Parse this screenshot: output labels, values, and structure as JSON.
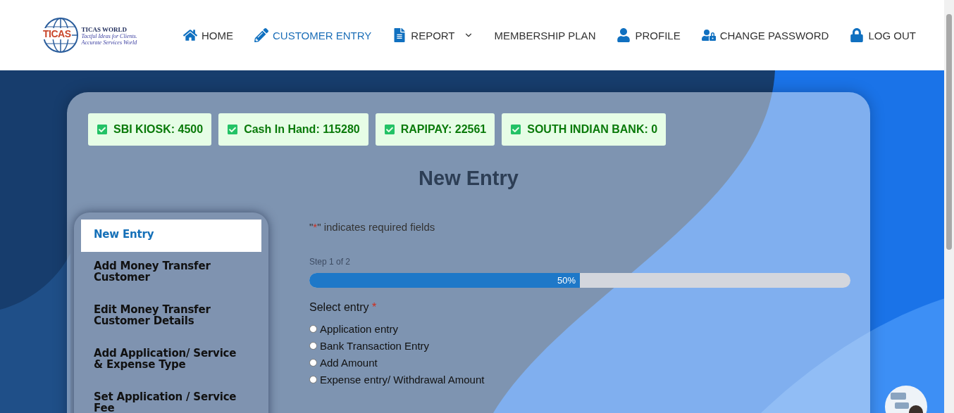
{
  "logo": {
    "mark": "TICAS",
    "name": "TICAS WORLD",
    "tagline": "Tactful Ideas for Clients. Accurate Services World"
  },
  "nav": [
    {
      "label": "HOME",
      "kind": "home",
      "selected": false
    },
    {
      "label": "CUSTOMER ENTRY",
      "kind": "pencil",
      "selected": true
    },
    {
      "label": "REPORT",
      "kind": "file",
      "selected": false,
      "dropdown": true
    },
    {
      "label": "MEMBERSHIP PLAN",
      "kind": "plain",
      "selected": false
    },
    {
      "label": "PROFILE",
      "kind": "user",
      "selected": false
    },
    {
      "label": "CHANGE PASSWORD",
      "kind": "userlock",
      "selected": false
    },
    {
      "label": "LOG OUT",
      "kind": "lock",
      "selected": false
    }
  ],
  "balances": [
    {
      "label": "SBI KIOSK: 4500",
      "checked": true
    },
    {
      "label": "Cash In Hand: 115280",
      "checked": true
    },
    {
      "label": "RAPIPAY: 22561",
      "checked": true
    },
    {
      "label": "SOUTH INDIAN BANK: 0",
      "checked": true
    }
  ],
  "page_title": "New Entry",
  "sidebar": {
    "items": [
      {
        "label": "New Entry",
        "selected": true
      },
      {
        "label": "Add Money Transfer Customer",
        "selected": false
      },
      {
        "label": "Edit Money Transfer Customer Details",
        "selected": false
      },
      {
        "label": "Add Application/ Service & Expense Type",
        "selected": false
      },
      {
        "label": "Set Application / Service Fee",
        "selected": false
      }
    ]
  },
  "form": {
    "required_note": {
      "before": "\"",
      "mark": "*",
      "after": "\" indicates required fields"
    },
    "step": "Step 1 of 2",
    "progress": {
      "level": 0.5,
      "label": "50%"
    },
    "field": {
      "label": "Select entry",
      "required": true,
      "required_mark": "*",
      "options": [
        {
          "label": "Application entry",
          "selected": false
        },
        {
          "label": "Bank Transaction Entry",
          "selected": false
        },
        {
          "label": "Add Amount",
          "selected": false
        },
        {
          "label": "Expense entry/ Withdrawal Amount",
          "selected": false
        }
      ]
    }
  }
}
